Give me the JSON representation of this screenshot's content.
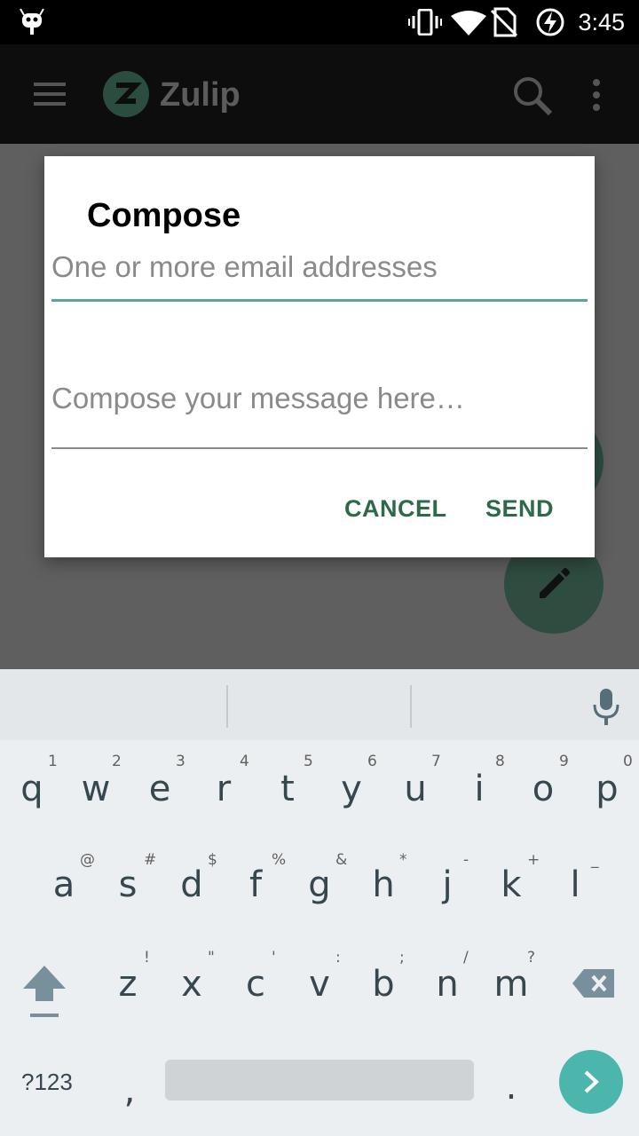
{
  "status_bar": {
    "time": "3:45",
    "icons": [
      "android-debug-icon",
      "vibrate-icon",
      "wifi-icon",
      "no-sim-icon",
      "battery-charging-icon"
    ]
  },
  "app_bar": {
    "title": "Zulip",
    "menu_icon": "hamburger-icon",
    "search_icon": "search-icon",
    "overflow_icon": "more-vert-icon"
  },
  "dialog": {
    "title": "Compose",
    "recipients_placeholder": "One or more email addresses",
    "message_placeholder": "Compose your message here…",
    "cancel_label": "CANCEL",
    "send_label": "SEND"
  },
  "keyboard": {
    "row1": [
      "q",
      "w",
      "e",
      "r",
      "t",
      "y",
      "u",
      "i",
      "o",
      "p"
    ],
    "row1_hints": [
      "1",
      "2",
      "3",
      "4",
      "5",
      "6",
      "7",
      "8",
      "9",
      "0"
    ],
    "row2": [
      "a",
      "s",
      "d",
      "f",
      "g",
      "h",
      "j",
      "k",
      "l"
    ],
    "row2_hints": [
      "@",
      "#",
      "$",
      "%",
      "&",
      "*",
      "-",
      "+",
      "_"
    ],
    "row3": [
      "z",
      "x",
      "c",
      "v",
      "b",
      "n",
      "m"
    ],
    "row3_hints": [
      "!",
      "\"",
      "'",
      ":",
      ";",
      "/",
      "?"
    ],
    "symbols_label": "?123",
    "comma": ",",
    "period": "."
  },
  "colors": {
    "accent": "#2d6b48",
    "field_underline": "#56a99a",
    "enter_key": "#4db6ac"
  }
}
